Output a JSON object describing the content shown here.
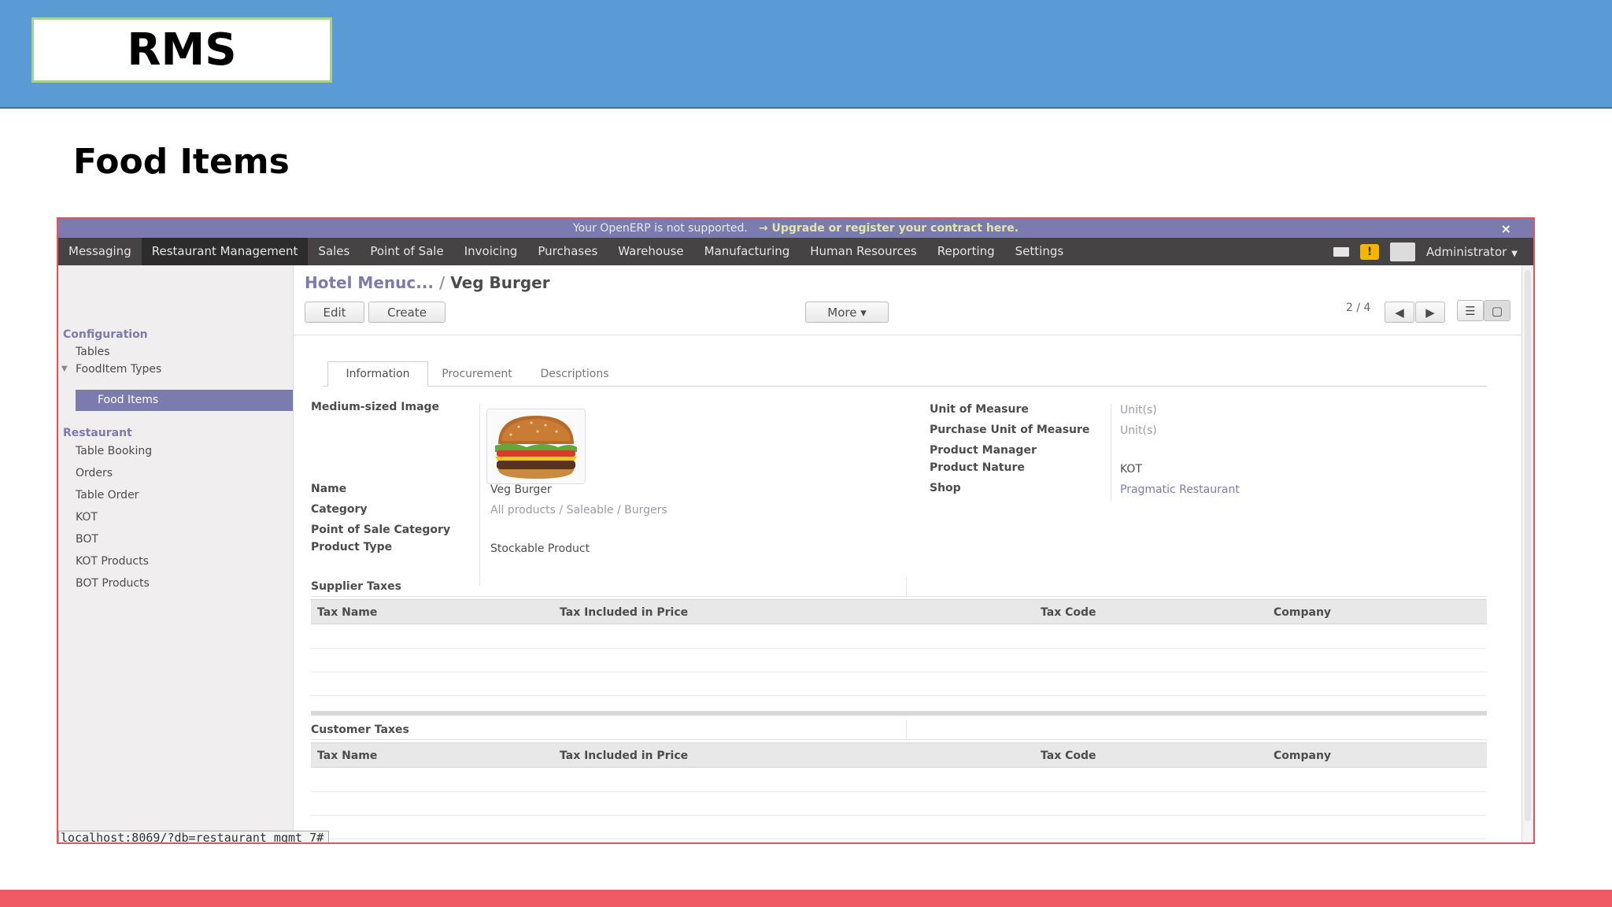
{
  "slide": {
    "header_title": "RMS",
    "page_title": "Food Items"
  },
  "app": {
    "notice": {
      "text": "Your OpenERP is not supported.",
      "link": "→ Upgrade or register your contract here.",
      "close": "×"
    },
    "menu": [
      "Messaging",
      "Restaurant Management",
      "Sales",
      "Point of Sale",
      "Invoicing",
      "Purchases",
      "Warehouse",
      "Manufacturing",
      "Human Resources",
      "Reporting",
      "Settings"
    ],
    "active_menu": "Restaurant Management",
    "user": "Administrator",
    "warning_glyph": "!",
    "sidebar": {
      "configuration": "Configuration",
      "tables": "Tables",
      "fooditem_types": "FoodItem Types",
      "food_items": "Food Items",
      "restaurant": "Restaurant",
      "items": [
        "Table Booking",
        "Orders",
        "Table Order",
        "KOT",
        "BOT",
        "KOT Products",
        "BOT Products"
      ]
    },
    "breadcrumb": {
      "parent": "Hotel Menuc...",
      "sep": "/",
      "current": "Veg Burger"
    },
    "buttons": {
      "edit": "Edit",
      "create": "Create",
      "more": "More ▾"
    },
    "pager": "2 / 4",
    "tabs": [
      "Information",
      "Procurement",
      "Descriptions"
    ],
    "form_left": {
      "medium_image_label": "Medium-sized Image",
      "name_label": "Name",
      "name_value": "Veg Burger",
      "category_label": "Category",
      "category_value": "All products / Saleable / Burgers",
      "pos_category_label": "Point of Sale Category",
      "pos_category_value": "",
      "product_type_label": "Product Type",
      "product_type_value": "Stockable Product"
    },
    "form_right": {
      "uom_label": "Unit of Measure",
      "uom_value": "Unit(s)",
      "purchase_uom_label": "Purchase Unit of Measure",
      "purchase_uom_value": "Unit(s)",
      "manager_label": "Product Manager",
      "manager_value": "",
      "nature_label": "Product Nature",
      "nature_value": "KOT",
      "shop_label": "Shop",
      "shop_value": "Pragmatic Restaurant"
    },
    "supplier_taxes": {
      "title": "Supplier Taxes",
      "columns": [
        "Tax Name",
        "Tax Included in Price",
        "Tax Code",
        "Company"
      ]
    },
    "customer_taxes": {
      "title": "Customer Taxes",
      "columns": [
        "Tax Name",
        "Tax Included in Price",
        "Tax Code",
        "Company"
      ]
    },
    "status_url": "localhost:8069/?db=restaurant_mgmt_7#"
  },
  "colors": {
    "slide_header": "#5b9bd5",
    "accent": "#7c7bad",
    "topbar": "#454343",
    "bottom_bar": "#ef5a64",
    "frame": "#e8505b"
  }
}
